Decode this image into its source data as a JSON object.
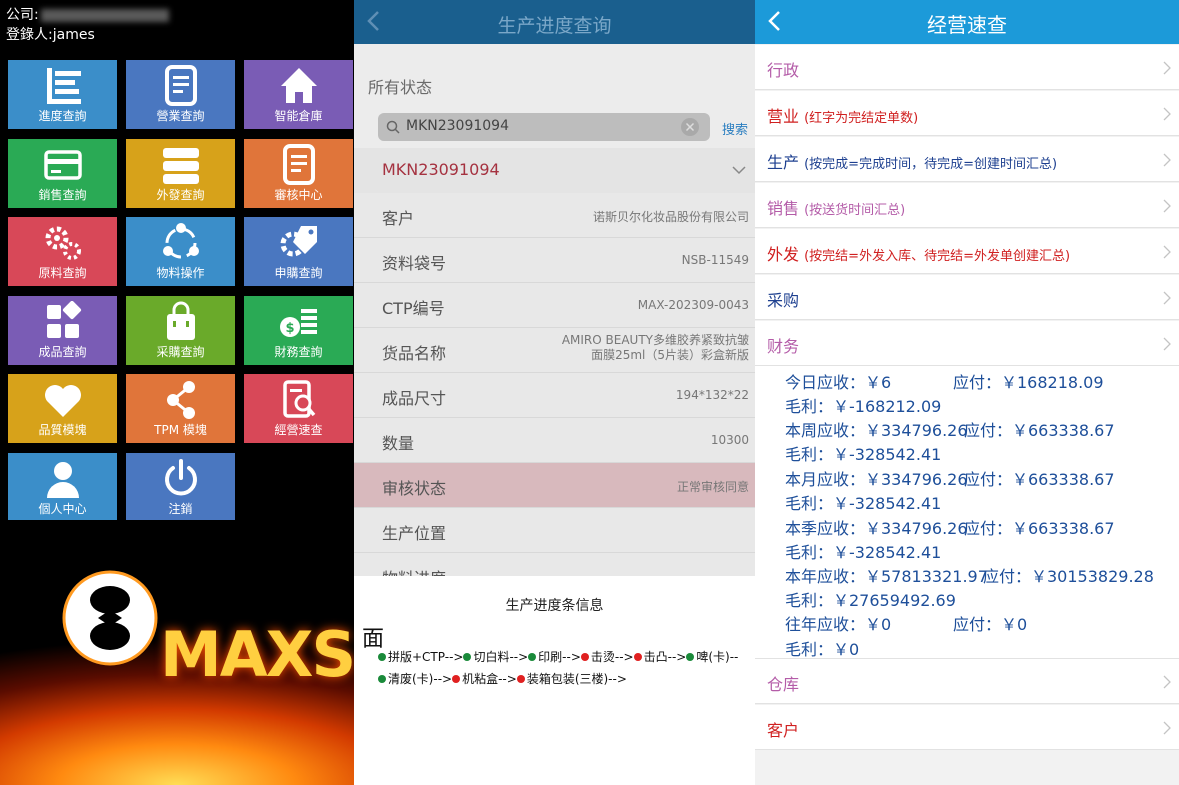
{
  "panel1": {
    "company_label": "公司:",
    "login_label": "登錄人:",
    "login_user": "james",
    "tiles": [
      {
        "label": "進度查詢",
        "icon": "list-icon",
        "color": "#3b8ec9"
      },
      {
        "label": "營業查詢",
        "icon": "document-icon",
        "color": "#4a77c0"
      },
      {
        "label": "智能倉庫",
        "icon": "home-icon",
        "color": "#7a5cb5"
      },
      {
        "label": "銷售查詢",
        "icon": "card-icon",
        "color": "#2aaa55"
      },
      {
        "label": "外發查詢",
        "icon": "stack-icon",
        "color": "#d7a21a"
      },
      {
        "label": "審核中心",
        "icon": "document-icon",
        "color": "#e0753a"
      },
      {
        "label": "原料查詢",
        "icon": "gears-icon",
        "color": "#d84858"
      },
      {
        "label": "物料操作",
        "icon": "cycle-icon",
        "color": "#3b8ec9"
      },
      {
        "label": "申購查詢",
        "icon": "gear-tag-icon",
        "color": "#4a77c0"
      },
      {
        "label": "成品查詢",
        "icon": "grid-icon",
        "color": "#7a5cb5"
      },
      {
        "label": "采購查詢",
        "icon": "bag-icon",
        "color": "#6aaa2a"
      },
      {
        "label": "財務查詢",
        "icon": "money-icon",
        "color": "#2aaa55"
      },
      {
        "label": "品質模塊",
        "icon": "heart-icon",
        "color": "#d7a21a"
      },
      {
        "label": "TPM 模塊",
        "icon": "share-icon",
        "color": "#e0753a"
      },
      {
        "label": "經營速查",
        "icon": "search-doc-icon",
        "color": "#d84858"
      },
      {
        "label": "個人中心",
        "icon": "person-icon",
        "color": "#3b8ec9"
      },
      {
        "label": "注銷",
        "icon": "power-icon",
        "color": "#4a77c0"
      }
    ],
    "logo_text": "MAXS"
  },
  "panel2": {
    "title": "生产进度查询",
    "status_label": "所有状态",
    "search_value": "MKN23091094",
    "search_button": "搜索",
    "order_no": "MKN23091094",
    "rows": [
      {
        "label": "客户",
        "value": "诺斯贝尔化妆品股份有限公司"
      },
      {
        "label": "资料袋号",
        "value": "NSB-11549"
      },
      {
        "label": "CTP编号",
        "value": "MAX-202309-0043"
      },
      {
        "label": "货品名称",
        "value": "AMIRO BEAUTY多维胶养紧致抗皱面膜25ml（5片装）彩盒新版"
      },
      {
        "label": "成品尺寸",
        "value": "194*132*22"
      },
      {
        "label": "数量",
        "value": "10300"
      },
      {
        "label": "审核状态",
        "value": "正常审核同意"
      },
      {
        "label": "生产位置",
        "value": ""
      },
      {
        "label": "物料进度",
        "value": ""
      }
    ],
    "modal": {
      "title": "生产进度条信息",
      "mian": "面",
      "line1": [
        {
          "text": "拼版+CTP-->",
          "status": "done"
        },
        {
          "text": "切白料-->",
          "status": "done"
        },
        {
          "text": "印刷-->",
          "status": "done"
        },
        {
          "text": "击烫-->",
          "status": "pending"
        },
        {
          "text": "击凸-->",
          "status": "pending"
        },
        {
          "text": "啤(卡)--",
          "status": "done"
        }
      ],
      "line2": [
        {
          "text": "清废(卡)-->",
          "status": "done"
        },
        {
          "text": "机粘盒-->",
          "status": "pending"
        },
        {
          "text": "装箱包装(三楼)-->",
          "status": "pending"
        }
      ]
    },
    "colors": {
      "done": "#1a8a3a",
      "pending": "#e02020"
    }
  },
  "panel3": {
    "title": "经营速查",
    "rows": [
      {
        "label": "行政",
        "sub": "",
        "color": "pink"
      },
      {
        "label": "营业",
        "sub": "(红字为完结定单数)",
        "color": "red"
      },
      {
        "label": "生产",
        "sub": "(按完成=完成时间，待完成=创建时间汇总)",
        "color": "navy"
      },
      {
        "label": "销售",
        "sub": "(按送货时间汇总)",
        "color": "pink"
      },
      {
        "label": "外发",
        "sub": "(按完结=外发入库、待完结=外发单创建汇总)",
        "color": "red"
      },
      {
        "label": "采购",
        "sub": "",
        "color": "navy"
      },
      {
        "label": "财务",
        "sub": "",
        "color": "pink"
      }
    ],
    "finance": [
      {
        "receivable": "今日应收：￥6",
        "payable": "应付：￥168218.09",
        "profit": "毛利：￥-168212.09"
      },
      {
        "receivable": "本周应收：￥334796.26",
        "payable": "应付：￥663338.67",
        "profit": "毛利：￥-328542.41"
      },
      {
        "receivable": "本月应收：￥334796.26",
        "payable": "应付：￥663338.67",
        "profit": "毛利：￥-328542.41"
      },
      {
        "receivable": "本季应收：￥334796.26",
        "payable": "应付：￥663338.67",
        "profit": "毛利：￥-328542.41"
      },
      {
        "receivable": "本年应收：￥57813321.97",
        "payable": "应付：￥30153829.28",
        "profit": "毛利：￥27659492.69"
      },
      {
        "receivable": "往年应收：￥0",
        "payable": "应付：￥0",
        "profit": "毛利：￥0"
      }
    ],
    "rows_bottom": [
      {
        "label": "仓库",
        "color": "pink"
      },
      {
        "label": "客户",
        "color": "red"
      }
    ]
  }
}
